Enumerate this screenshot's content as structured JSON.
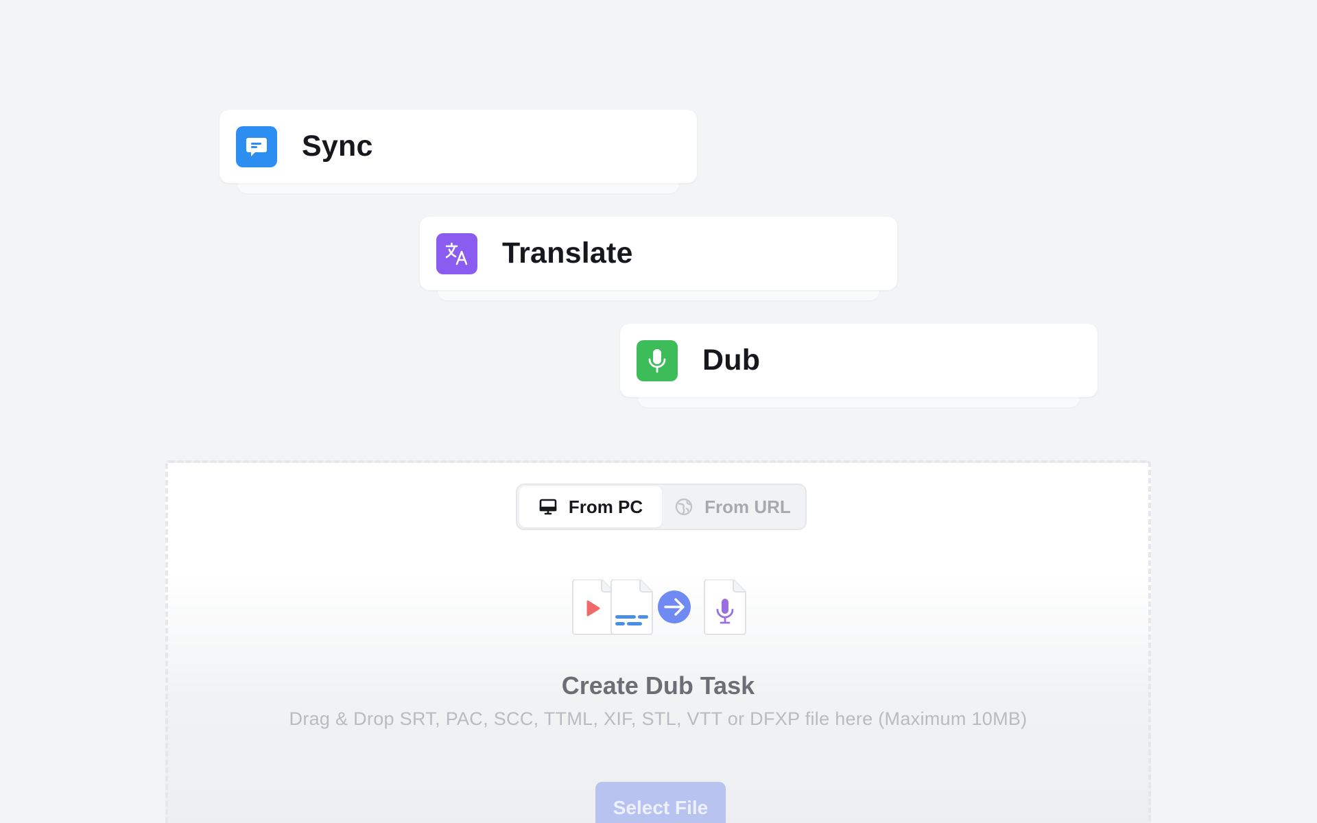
{
  "cards": [
    {
      "label": "Sync",
      "icon": "chat-bubble-icon",
      "color": "#2b8ef0"
    },
    {
      "label": "Translate",
      "icon": "translate-icon",
      "color": "#8b5cf0"
    },
    {
      "label": "Dub",
      "icon": "microphone-icon",
      "color": "#3dbd5a"
    }
  ],
  "upload": {
    "tabs": [
      {
        "label": "From PC",
        "icon": "monitor-icon",
        "active": true
      },
      {
        "label": "From URL",
        "icon": "globe-icon",
        "active": false
      }
    ],
    "title": "Create Dub Task",
    "description": "Drag & Drop SRT, PAC, SCC, TTML, XIF, STL, VTT or DFXP file here (Maximum 10MB)",
    "button_label": "Select File"
  },
  "colors": {
    "accent": "#6f8bf3",
    "button_disabled": "#b8c3f0",
    "play_red": "#f06a6a",
    "subtitle_blue": "#4a8fe6",
    "mic_purple": "#9b6fe0"
  }
}
